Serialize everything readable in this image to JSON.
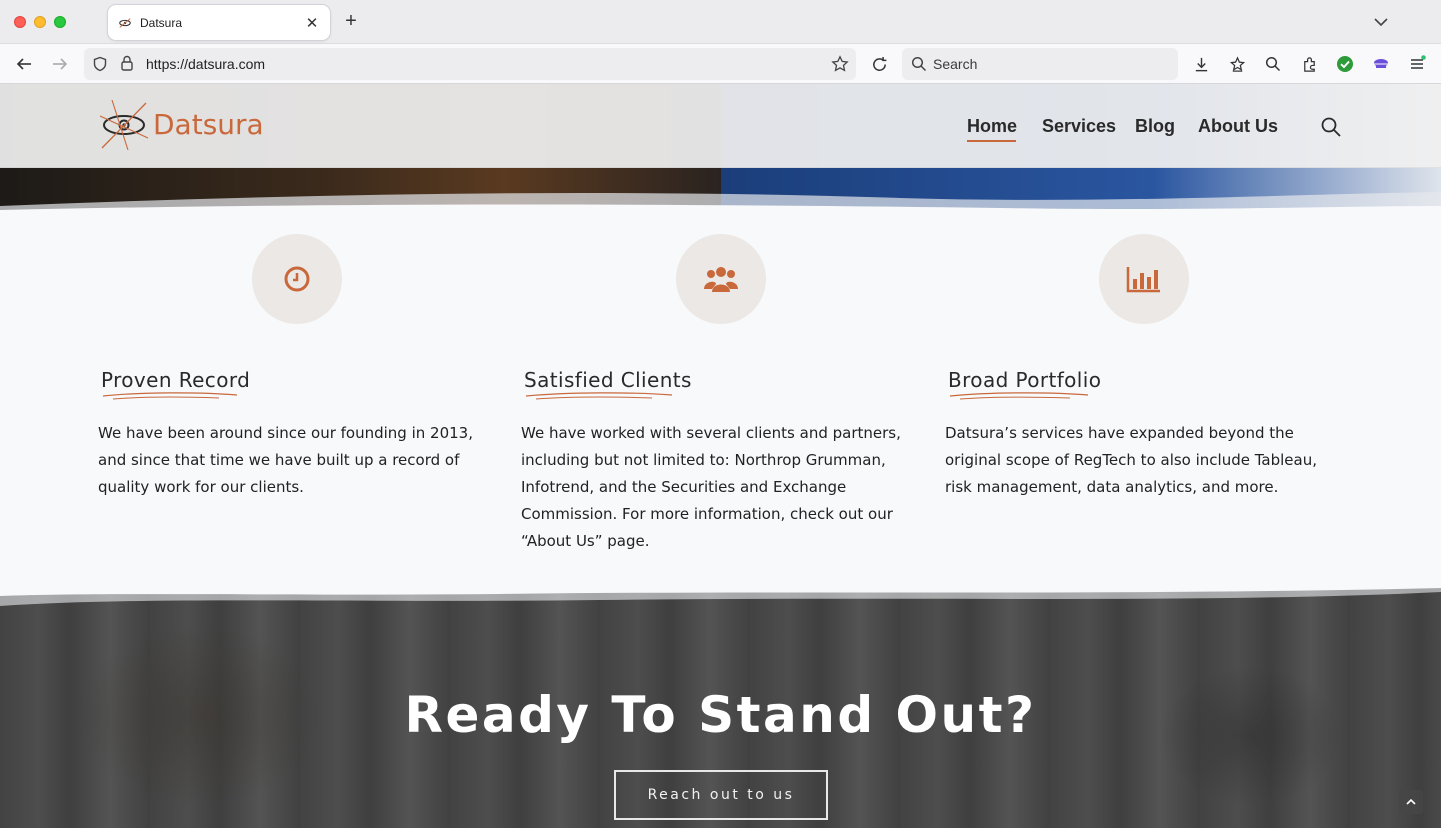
{
  "browser": {
    "tab_title": "Datsura",
    "url": "https://datsura.com",
    "search_placeholder": "Search"
  },
  "site": {
    "logo_text": "Datsura",
    "brand_color": "#c8683b",
    "menu": {
      "home": "Home",
      "services": "Services",
      "blog": "Blog",
      "about": "About Us"
    }
  },
  "features": [
    {
      "icon": "clock-icon",
      "title": "Proven Record",
      "text": "We have been around since our founding in 2013, and since that time we have built up a record of quality work for our clients."
    },
    {
      "icon": "users-icon",
      "title": "Satisfied Clients",
      "text": "We have worked with several clients and partners, including but not limited to: Northrop Grumman, Infotrend, and the Securities and Exchange Commission. For more information, check out our “About Us” page."
    },
    {
      "icon": "bar-chart-icon",
      "title": "Broad Portfolio",
      "text": "Datsura’s services have expanded beyond the original scope of RegTech to also include Tableau, risk management, data analytics, and more."
    }
  ],
  "cta": {
    "title": "Ready To Stand Out?",
    "button": "Reach out to us"
  }
}
